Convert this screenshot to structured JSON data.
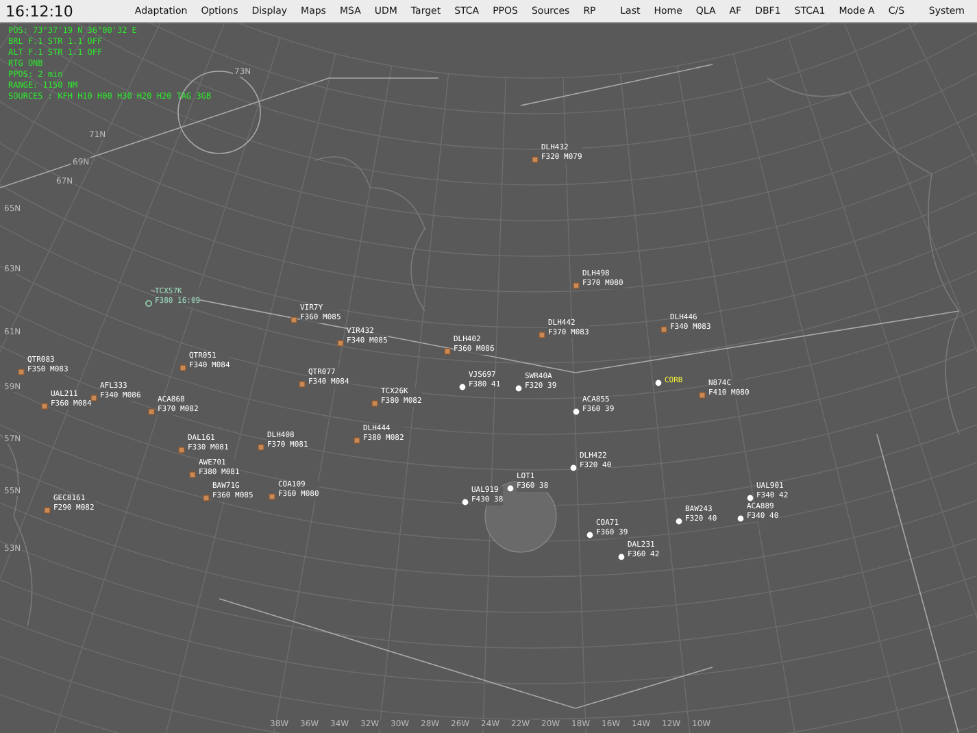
{
  "menu_bar": {
    "clock": "16:12:10",
    "left_items": [
      "Adaptation",
      "Options",
      "Display",
      "Maps",
      "MSA",
      "UDM",
      "Target",
      "STCA",
      "PPOS",
      "Sources",
      "RP"
    ],
    "right_items": [
      "Last",
      "Home",
      "QLA",
      "AF",
      "DBF1",
      "STCA1",
      "Mode A",
      "C/S"
    ],
    "system": "System"
  },
  "status_lines": [
    "POS: 73°37'19 N  36°00'32 E",
    "BRL F.1 STR 1.1 OFF",
    "ALT F.1 STR 1.1 OFF",
    "RTG ONB",
    "PPOS: 2 min",
    "RANGE: 1150 NM",
    "SOURCES : KFH H10 H00 H30 H20 H20 TAG 3GB"
  ],
  "latitude_labels": [
    "73N",
    "71N",
    "69N",
    "67N",
    "65N",
    "63N",
    "61N",
    "59N",
    "57N",
    "55N",
    "53N"
  ],
  "longitude_labels": [
    "38W",
    "36W",
    "34W",
    "32W",
    "30W",
    "28W",
    "26W",
    "24W",
    "22W",
    "20W",
    "18W",
    "16W",
    "14W",
    "12W",
    "10W"
  ],
  "aircraft": [
    {
      "callsign": "DLH432",
      "level": "F320 M079",
      "kind": "tracked",
      "highlighted": false
    },
    {
      "callsign": "DLH498",
      "level": "F370 M080",
      "kind": "tracked",
      "highlighted": false
    },
    {
      "callsign": "DLH442",
      "level": "F370 M083",
      "kind": "tracked",
      "highlighted": false
    },
    {
      "callsign": "DLH446",
      "level": "F340 M083",
      "kind": "tracked",
      "highlighted": false
    },
    {
      "callsign": "VIR7Y",
      "level": "F360 M085",
      "kind": "tracked",
      "highlighted": false
    },
    {
      "callsign": "VIR432",
      "level": "F340 M085",
      "kind": "tracked",
      "highlighted": false
    },
    {
      "callsign": "DLH402",
      "level": "F360 M086",
      "kind": "tracked",
      "highlighted": false
    },
    {
      "callsign": "QTR077",
      "level": "F340 M084",
      "kind": "tracked",
      "highlighted": false
    },
    {
      "callsign": "QTR051",
      "level": "F340 M084",
      "kind": "tracked",
      "highlighted": false
    },
    {
      "callsign": "QTR083",
      "level": "F350 M083",
      "kind": "tracked",
      "highlighted": false
    },
    {
      "callsign": "UAL211",
      "level": "F360 M084",
      "kind": "tracked",
      "highlighted": false
    },
    {
      "callsign": "AFL333",
      "level": "F340 M086",
      "kind": "tracked",
      "highlighted": false
    },
    {
      "callsign": "ACA868",
      "level": "F370 M082",
      "kind": "tracked",
      "highlighted": false
    },
    {
      "callsign": "VJS697",
      "level": "F380 41",
      "kind": "radar",
      "highlighted": false
    },
    {
      "callsign": "SWR40A",
      "level": "F320 39",
      "kind": "radar",
      "highlighted": false
    },
    {
      "callsign": "TCX26K",
      "level": "F380 M082",
      "kind": "tracked",
      "highlighted": false
    },
    {
      "callsign": "ACA855",
      "level": "F360 39",
      "kind": "radar",
      "highlighted": false
    },
    {
      "callsign": "N874C",
      "level": "F410 M080",
      "kind": "tracked",
      "highlighted": false
    },
    {
      "callsign": "DLH444",
      "level": "F380 M082",
      "kind": "tracked",
      "highlighted": false
    },
    {
      "callsign": "DAL161",
      "level": "F330 M081",
      "kind": "tracked",
      "highlighted": false
    },
    {
      "callsign": "DLH408",
      "level": "F370 M081",
      "kind": "tracked",
      "highlighted": false
    },
    {
      "callsign": "AWE701",
      "level": "F380 M081",
      "kind": "tracked",
      "highlighted": false
    },
    {
      "callsign": "BAW71G",
      "level": "F360 M085",
      "kind": "tracked",
      "highlighted": false
    },
    {
      "callsign": "GEC8161",
      "level": "F290 M082",
      "kind": "tracked",
      "highlighted": false
    },
    {
      "callsign": "COA109",
      "level": "F360 M080",
      "kind": "tracked",
      "highlighted": false
    },
    {
      "callsign": "UAL919",
      "level": "F430 38",
      "kind": "radar",
      "highlighted": false
    },
    {
      "callsign": "LOT1",
      "level": "F360 38",
      "kind": "radar",
      "highlighted": false
    },
    {
      "callsign": "DLH422",
      "level": "F320 40",
      "kind": "radar",
      "highlighted": false
    },
    {
      "callsign": "COA71",
      "level": "F360 39",
      "kind": "radar",
      "highlighted": false
    },
    {
      "callsign": "DAL231",
      "level": "F360 42",
      "kind": "radar",
      "highlighted": false
    },
    {
      "callsign": "BAW243",
      "level": "F320 40",
      "kind": "radar",
      "highlighted": false
    },
    {
      "callsign": "UAL901",
      "level": "F340 42",
      "kind": "radar",
      "highlighted": false
    },
    {
      "callsign": "ACA889",
      "level": "F340 40",
      "kind": "radar",
      "highlighted": false
    },
    {
      "callsign": "CORB",
      "kind": "radar",
      "highlighted": true
    },
    {
      "callsign": "TCX57K",
      "level": "F380 16:09",
      "kind": "coasting",
      "highlighted": false
    }
  ]
}
